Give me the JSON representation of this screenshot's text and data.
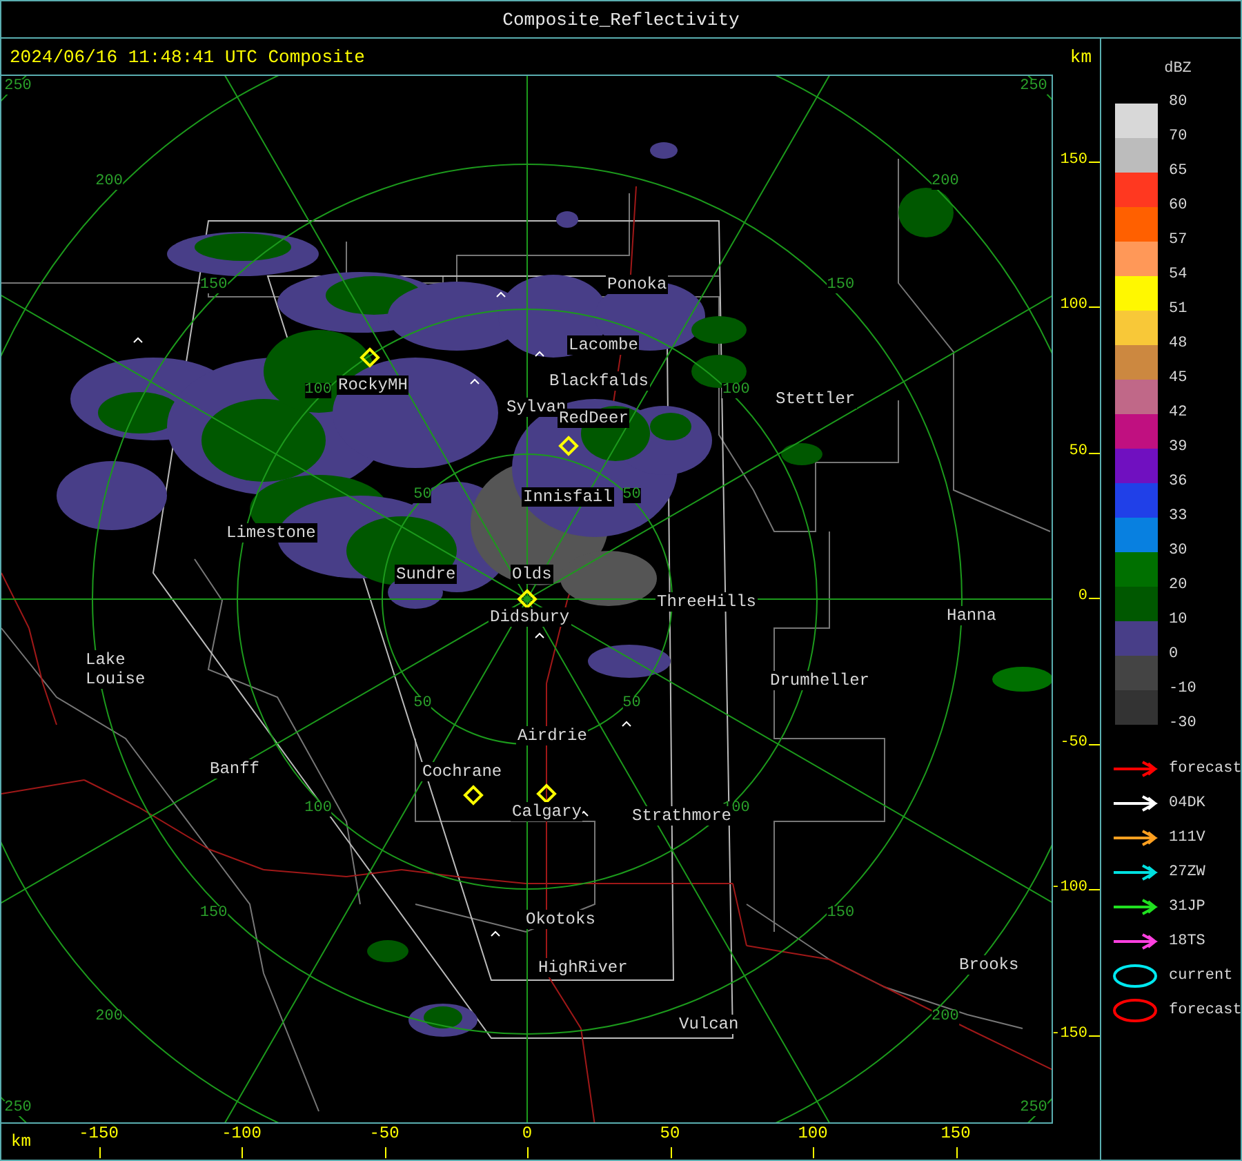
{
  "window": {
    "title": "Composite_Reflectivity"
  },
  "header": {
    "timestamp": "2024/06/16 11:48:41 UTC Composite",
    "unit": "km"
  },
  "map": {
    "cities": [
      "Ponoka",
      "Lacombe",
      "Blackfalds",
      "RockyMH",
      "Sylvan",
      "RedDeer",
      "Stettler",
      "Innisfail",
      "Limestone",
      "Sundre",
      "Olds",
      "ThreeHills",
      "Didsbury",
      "Hanna",
      "Lake Louise",
      "Drumheller",
      "Airdrie",
      "Banff",
      "Cochrane",
      "Calgary",
      "Strathmore",
      "Okotoks",
      "HighRiver",
      "Brooks",
      "Vulcan"
    ],
    "ring_labels": {
      "nw": [
        "50",
        "100",
        "150",
        "200",
        "250"
      ],
      "ne": [
        "50",
        "100",
        "150",
        "200",
        "250"
      ],
      "sw": [
        "50",
        "100",
        "150",
        "200",
        "250"
      ],
      "se": [
        "50",
        "100",
        "150",
        "200",
        "250"
      ]
    }
  },
  "x_axis": {
    "unit": "km",
    "ticks": [
      "-150",
      "-100",
      "-50",
      "0",
      "50",
      "100",
      "150"
    ]
  },
  "y_axis": {
    "ticks": [
      "150",
      "100",
      "50",
      "0",
      "-50",
      "-100",
      "-150"
    ]
  },
  "scale": {
    "unit": "dBZ",
    "bands": [
      {
        "color": "#d8d8d8"
      },
      {
        "color": "#bcbcbc"
      },
      {
        "color": "#ff3820"
      },
      {
        "color": "#ff6000"
      },
      {
        "color": "#ff9858"
      },
      {
        "color": "#fff800"
      },
      {
        "color": "#f8c838"
      },
      {
        "color": "#cc8840"
      },
      {
        "color": "#c06888"
      },
      {
        "color": "#c01080"
      },
      {
        "color": "#7010c0"
      },
      {
        "color": "#2040e8"
      },
      {
        "color": "#0880e0"
      },
      {
        "color": "#007000"
      },
      {
        "color": "#005800"
      },
      {
        "color": "#483e88"
      },
      {
        "color": "#444444"
      },
      {
        "color": "#333333"
      }
    ],
    "ticks": [
      "80",
      "70",
      "65",
      "60",
      "57",
      "54",
      "51",
      "48",
      "45",
      "42",
      "39",
      "36",
      "33",
      "30",
      "20",
      "10",
      "0",
      "-10",
      "-30"
    ]
  },
  "tracks": [
    {
      "kind": "arrow",
      "color": "#ff0000",
      "label": "forecast"
    },
    {
      "kind": "arrow",
      "color": "#ffffff",
      "label": "04DK"
    },
    {
      "kind": "arrow",
      "color": "#ffa020",
      "label": "111V"
    },
    {
      "kind": "arrow",
      "color": "#00e0e0",
      "label": "27ZW"
    },
    {
      "kind": "arrow",
      "color": "#20e020",
      "label": "31JP"
    },
    {
      "kind": "arrow",
      "color": "#ff40e0",
      "label": "18TS"
    },
    {
      "kind": "ellipse",
      "color": "#00e8f0",
      "label": "current"
    },
    {
      "kind": "ellipse",
      "color": "#ff0000",
      "label": "forecast"
    }
  ]
}
